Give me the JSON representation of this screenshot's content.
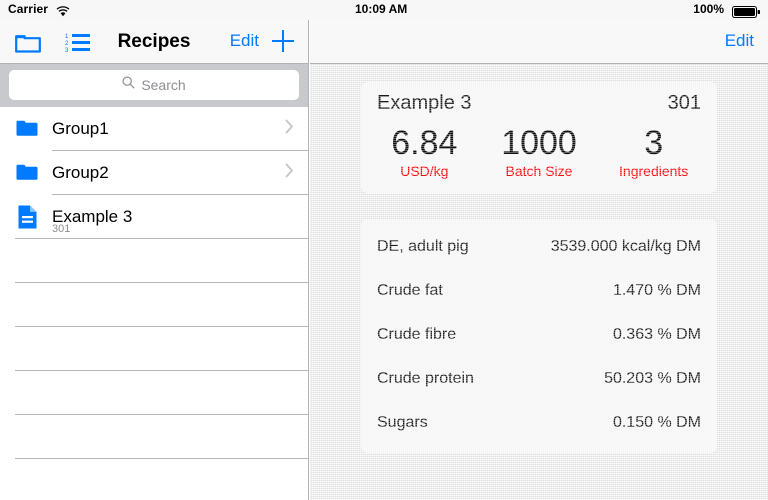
{
  "statusbar": {
    "carrier": "Carrier",
    "wifi_icon": "wifi-icon",
    "time": "10:09 AM",
    "battery_percent": "100%",
    "battery_icon": "battery-full-icon"
  },
  "left": {
    "navbar": {
      "folder_icon": "folder-outline-icon",
      "list_icon": "numbered-list-icon",
      "title": "Recipes",
      "edit_label": "Edit",
      "add_icon": "plus-icon"
    },
    "search": {
      "placeholder": "Search",
      "icon": "search-icon",
      "value": ""
    },
    "rows": [
      {
        "title": "Group1",
        "subtitle": "",
        "icon": "folder-filled-icon",
        "accessory": "chevron-right-icon",
        "type": "group"
      },
      {
        "title": "Group2",
        "subtitle": "",
        "icon": "folder-filled-icon",
        "accessory": "chevron-right-icon",
        "type": "group"
      },
      {
        "title": "Example 3",
        "subtitle": "301",
        "icon": "document-icon",
        "accessory": "",
        "type": "recipe"
      }
    ],
    "empty_row_count": 5
  },
  "right": {
    "navbar": {
      "edit_label": "Edit"
    },
    "summary_card": {
      "name": "Example 3",
      "code": "301",
      "stats": [
        {
          "value": "6.84",
          "label": "USD/kg"
        },
        {
          "value": "1000",
          "label": "Batch Size"
        },
        {
          "value": "3",
          "label": "Ingredients"
        }
      ]
    },
    "nutrient_rows": [
      {
        "label": "DE, adult pig",
        "value": "3539.000 kcal/kg DM"
      },
      {
        "label": "Crude fat",
        "value": "1.470 % DM"
      },
      {
        "label": "Crude fibre",
        "value": "0.363 % DM"
      },
      {
        "label": "Crude protein",
        "value": "50.203 % DM"
      },
      {
        "label": "Sugars",
        "value": "0.150 % DM"
      }
    ]
  },
  "colors": {
    "accent_blue": "#007aff",
    "stat_label_red": "#ff0000",
    "separator": "#b6b6b6",
    "search_bar_bg": "#c8c9cd"
  }
}
